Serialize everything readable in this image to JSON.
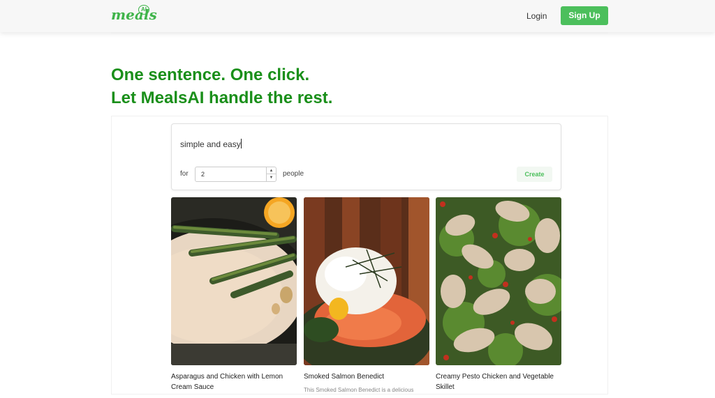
{
  "header": {
    "logo_text": "meals",
    "logo_badge": "AI",
    "login_label": "Login",
    "signup_label": "Sign Up",
    "brand_color": "#4cbf5c"
  },
  "hero": {
    "line1": "One sentence. One click.",
    "line2": "Let MealsAI handle the rest.",
    "color": "#1a8f1a"
  },
  "form": {
    "prompt_value": "simple and easy",
    "for_label": "for",
    "people_value": "2",
    "people_label": "people",
    "create_label": "Create"
  },
  "meals": [
    {
      "title": "Asparagus and Chicken with Lemon Cream Sauce",
      "description": ""
    },
    {
      "title": "Smoked Salmon Benedict",
      "description": "This Smoked Salmon Benedict is a delicious"
    },
    {
      "title": "Creamy Pesto Chicken and Vegetable Skillet",
      "description": ""
    }
  ]
}
